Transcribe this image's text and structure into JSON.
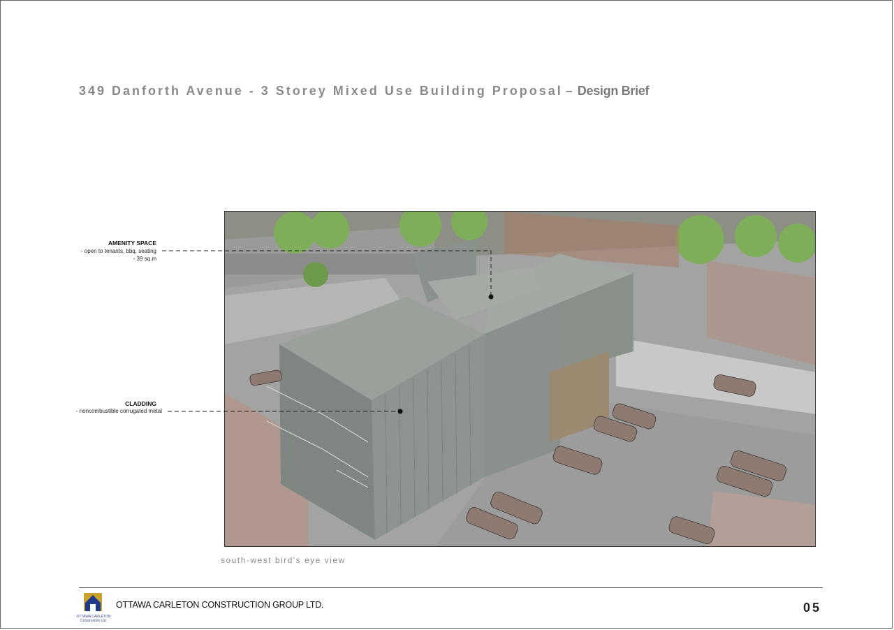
{
  "header": {
    "title": "349 Danforth Avenue - 3 Storey Mixed Use Building Proposal",
    "separator": "–",
    "subtitle": "Design Brief"
  },
  "callouts": {
    "amenity": {
      "title": "AMENITY SPACE",
      "line1": "- open to tenants, bbq, seating",
      "line2": "- 39 sq.m"
    },
    "cladding": {
      "title": "CLADDING",
      "line1": "- noncombustible corrugated metal"
    }
  },
  "render": {
    "caption": "south-west bird's eye view",
    "image_icon": "building-render-illustration"
  },
  "footer": {
    "company": "OTTAWA CARLETON CONSTRUCTION GROUP LTD.",
    "logo_text_line1": "OTTAWA CARLETON",
    "logo_text_line2": "Construction Ltd.",
    "page_number": "05",
    "logo_icon": "house-logo-icon"
  },
  "colors": {
    "title": "#8a8a8a",
    "logo_blue": "#1e3a8a",
    "logo_gold": "#c9a227"
  }
}
